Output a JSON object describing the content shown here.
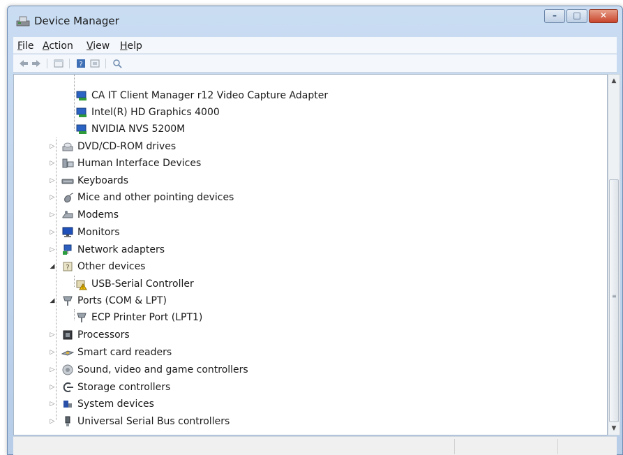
{
  "window": {
    "title": "Device Manager",
    "minimize_glyph": "–",
    "maximize_glyph": "□",
    "close_glyph": "✕"
  },
  "menu": {
    "items": [
      {
        "label": "File",
        "accel": "F",
        "rest": "ile"
      },
      {
        "label": "Action",
        "accel": "A",
        "rest": "ction"
      },
      {
        "label": "View",
        "accel": "V",
        "rest": "iew"
      },
      {
        "label": "Help",
        "accel": "H",
        "rest": "elp"
      }
    ]
  },
  "toolbar": {
    "buttons": [
      "back-arrow-icon",
      "forward-arrow-icon",
      "properties-icon",
      "help-icon",
      "update-driver-icon",
      "scan-hardware-icon"
    ]
  },
  "tree": {
    "display_children": [
      {
        "label": "CA IT Client Manager r12 Video Capture Adapter",
        "icon": "display-adapter-icon"
      },
      {
        "label": "Intel(R) HD Graphics 4000",
        "icon": "display-adapter-icon"
      },
      {
        "label": "NVIDIA NVS 5200M",
        "icon": "display-adapter-icon"
      }
    ],
    "categories": [
      {
        "label": "DVD/CD-ROM drives",
        "icon": "dvd-drive-icon",
        "expanded": false
      },
      {
        "label": "Human Interface Devices",
        "icon": "hid-icon",
        "expanded": false
      },
      {
        "label": "Keyboards",
        "icon": "keyboard-icon",
        "expanded": false
      },
      {
        "label": "Mice and other pointing devices",
        "icon": "mouse-icon",
        "expanded": false
      },
      {
        "label": "Modems",
        "icon": "modem-icon",
        "expanded": false
      },
      {
        "label": "Monitors",
        "icon": "monitor-icon",
        "expanded": false
      },
      {
        "label": "Network adapters",
        "icon": "network-adapter-icon",
        "expanded": false
      },
      {
        "label": "Other devices",
        "icon": "unknown-device-icon",
        "expanded": true
      },
      {
        "label": "USB-Serial Controller",
        "icon": "warning-device-icon",
        "child": true
      },
      {
        "label": "Ports (COM & LPT)",
        "icon": "port-icon",
        "expanded": true
      },
      {
        "label": "ECP Printer Port (LPT1)",
        "icon": "port-icon",
        "child": true
      },
      {
        "label": "Processors",
        "icon": "processor-icon",
        "expanded": false
      },
      {
        "label": "Smart card readers",
        "icon": "smart-card-icon",
        "expanded": false
      },
      {
        "label": "Sound, video and game controllers",
        "icon": "sound-icon",
        "expanded": false
      },
      {
        "label": "Storage controllers",
        "icon": "storage-controller-icon",
        "expanded": false
      },
      {
        "label": "System devices",
        "icon": "system-device-icon",
        "expanded": false
      },
      {
        "label": "Universal Serial Bus controllers",
        "icon": "usb-icon",
        "expanded": false
      }
    ]
  },
  "scrollbar": {
    "up_glyph": "▲",
    "down_glyph": "▼",
    "grip": "≡"
  },
  "colors": {
    "titlebar": "#c9dcf2",
    "close_button": "#c8452c",
    "selection": "#3399ff"
  }
}
